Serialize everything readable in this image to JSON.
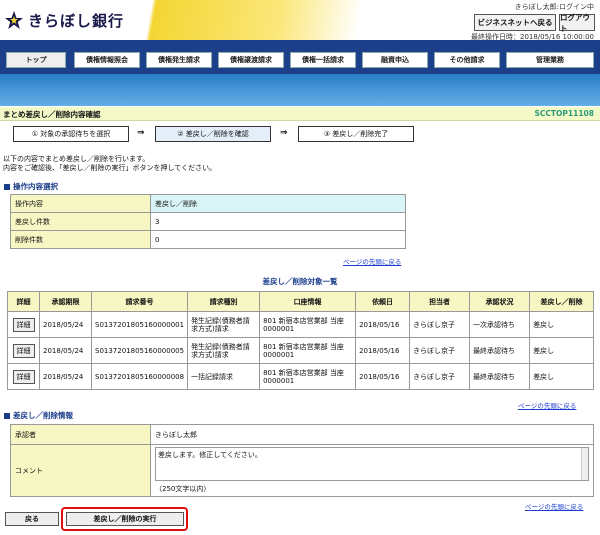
{
  "header": {
    "bank_name": "きらぼし銀行",
    "user_line": "きらぼし太郎:ログイン中",
    "btn_bizhelp": "ビジネスネットヘ戻る",
    "btn_logout": "ログアウト",
    "last_op": "最終操作日時：2018/05/16 10:00:00"
  },
  "nav": {
    "tabs": [
      "トップ",
      "債権情報照会",
      "債権発生請求",
      "債権譲渡請求",
      "債権一括請求",
      "融資申込",
      "その他請求",
      "管理業務"
    ]
  },
  "page": {
    "title": "まとめ差戻し／削除内容確認",
    "id": "SCCTOP11108"
  },
  "steps": [
    "① 対象の承認待ちを選択",
    "② 差戻し／削除を確認",
    "③ 差戻し／削除完了"
  ],
  "intro": [
    "以下の内容でまとめ差戻し／削除を行います。",
    "内容をご確認後、「差戻し／削除の実行」ボタンを押してください。"
  ],
  "op": {
    "section": "操作内容選択",
    "rows": [
      {
        "k": "操作内容",
        "v": "差戻し／削除"
      },
      {
        "k": "差戻し件数",
        "v": "3"
      },
      {
        "k": "削除件数",
        "v": "0"
      }
    ]
  },
  "toplink": "ページの先頭に戻る",
  "list": {
    "title": "差戻し／削除対象一覧",
    "headers": [
      "詳細",
      "承認期限",
      "請求番号",
      "請求種別",
      "口座情報",
      "依頼日",
      "担当者",
      "承認状況",
      "差戻し／削除"
    ],
    "detail_label": "詳細",
    "rows": [
      {
        "due": "2018/05/24",
        "no": "S0137201805160000001",
        "type": "発生記録(債務者請求方式)請求",
        "acct": "801 新宿本店営業部 当座 0000001",
        "req": "2018/05/16",
        "owner": "きらぼし京子",
        "status": "一次承認待ち",
        "act": "差戻し"
      },
      {
        "due": "2018/05/24",
        "no": "S0137201805160000005",
        "type": "発生記録(債務者請求方式)請求",
        "acct": "801 新宿本店営業部 当座 0000001",
        "req": "2018/05/16",
        "owner": "きらぼし京子",
        "status": "最終承認待ち",
        "act": "差戻し"
      },
      {
        "due": "2018/05/24",
        "no": "S0137201805160000008",
        "type": "一括記録請求",
        "acct": "801 新宿本店営業部 当座 0000001",
        "req": "2018/05/16",
        "owner": "きらぼし京子",
        "status": "最終承認待ち",
        "act": "差戻し"
      }
    ]
  },
  "info": {
    "section": "差戻し／削除情報",
    "approver_label": "承認者",
    "approver": "きらぼし太郎",
    "comment_label": "コメント",
    "comment": "差戻します。修正してください。",
    "limit": "（250文字以内）"
  },
  "buttons": {
    "back": "戻る",
    "execute": "差戻し／削除の実行"
  }
}
